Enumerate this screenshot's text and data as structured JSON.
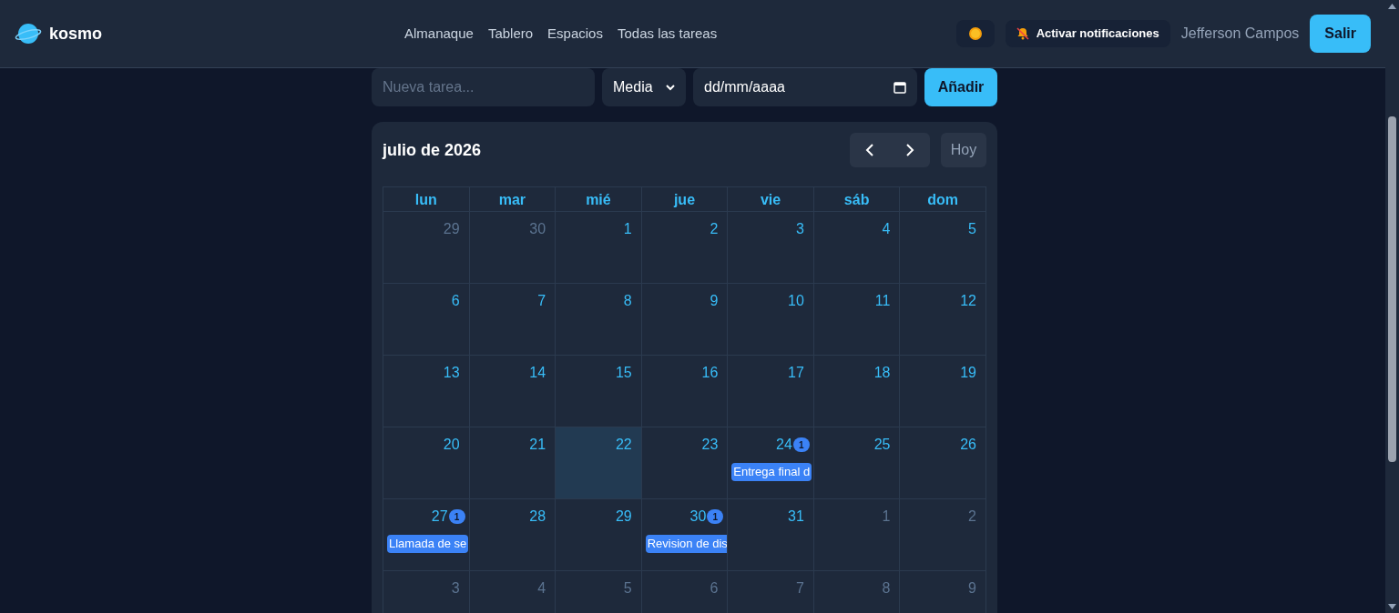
{
  "brand": {
    "name": "kosmo"
  },
  "nav": [
    {
      "label": "Almanaque"
    },
    {
      "label": "Tablero"
    },
    {
      "label": "Espacios"
    },
    {
      "label": "Todas las tareas"
    }
  ],
  "header_actions": {
    "notifications_label": "Activar notificaciones",
    "user_name": "Jefferson Campos",
    "logout_label": "Salir"
  },
  "task_form": {
    "title_placeholder": "Nueva tarea...",
    "priority": "Media",
    "date_placeholder": "dd/mm/aaaa",
    "add_label": "Añadir"
  },
  "calendar": {
    "title": "julio de 2026",
    "today_label": "Hoy",
    "weekdays": [
      "lun",
      "mar",
      "mié",
      "jue",
      "vie",
      "sáb",
      "dom"
    ],
    "weeks": [
      [
        {
          "day": "29",
          "outside": true
        },
        {
          "day": "30",
          "outside": true
        },
        {
          "day": "1"
        },
        {
          "day": "2"
        },
        {
          "day": "3"
        },
        {
          "day": "4"
        },
        {
          "day": "5"
        }
      ],
      [
        {
          "day": "6"
        },
        {
          "day": "7"
        },
        {
          "day": "8"
        },
        {
          "day": "9"
        },
        {
          "day": "10"
        },
        {
          "day": "11"
        },
        {
          "day": "12"
        }
      ],
      [
        {
          "day": "13"
        },
        {
          "day": "14"
        },
        {
          "day": "15"
        },
        {
          "day": "16"
        },
        {
          "day": "17"
        },
        {
          "day": "18"
        },
        {
          "day": "19"
        }
      ],
      [
        {
          "day": "20"
        },
        {
          "day": "21"
        },
        {
          "day": "22",
          "today": true
        },
        {
          "day": "23"
        },
        {
          "day": "24",
          "count": "1",
          "events": [
            "Entrega final d"
          ]
        },
        {
          "day": "25"
        },
        {
          "day": "26"
        }
      ],
      [
        {
          "day": "27",
          "count": "1",
          "events": [
            "Llamada de se"
          ]
        },
        {
          "day": "28"
        },
        {
          "day": "29"
        },
        {
          "day": "30",
          "count": "1",
          "events": [
            "Revision de dis"
          ]
        },
        {
          "day": "31"
        },
        {
          "day": "1",
          "outside": true
        },
        {
          "day": "2",
          "outside": true
        }
      ],
      [
        {
          "day": "3",
          "outside": true
        },
        {
          "day": "4",
          "outside": true
        },
        {
          "day": "5",
          "outside": true
        },
        {
          "day": "6",
          "outside": true
        },
        {
          "day": "7",
          "outside": true
        },
        {
          "day": "8",
          "outside": true
        },
        {
          "day": "9",
          "outside": true
        }
      ]
    ]
  }
}
